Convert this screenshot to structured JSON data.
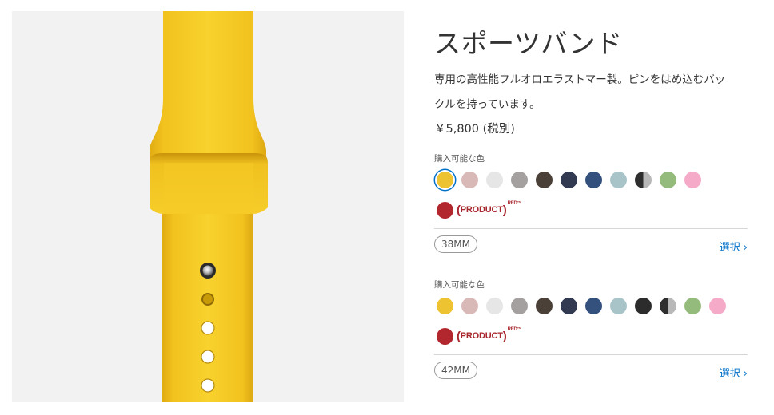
{
  "product": {
    "title": "スポーツバンド",
    "description": "専用の高性能フルオロエラストマー製。ピンをはめ込むバックルを持っています。",
    "price": "￥5,800 (税別)"
  },
  "colors": {
    "accent_link": "#0070c9",
    "band_yellow": "#f4c92a",
    "hero_background": "#f2f2f2"
  },
  "groups": [
    {
      "available_label": "購入可能な色",
      "swatches": [
        {
          "name": "yellow",
          "color": "#eec331",
          "selected": true
        },
        {
          "name": "pink-sand",
          "color": "#d9b9b8",
          "selected": false
        },
        {
          "name": "white",
          "color": "#e6e6e6",
          "selected": false
        },
        {
          "name": "stone",
          "color": "#a3a09f",
          "selected": false
        },
        {
          "name": "cocoa",
          "color": "#4b4038",
          "selected": false
        },
        {
          "name": "midnight-blue",
          "color": "#323a52",
          "selected": false
        },
        {
          "name": "ocean-blue",
          "color": "#34507d",
          "selected": false
        },
        {
          "name": "light-blue",
          "color": "#a8c4c9",
          "selected": false
        },
        {
          "name": "black-split",
          "color": "split",
          "selected": false
        },
        {
          "name": "green",
          "color": "#95bb7c",
          "selected": false
        },
        {
          "name": "light-pink",
          "color": "#f5aac8",
          "selected": false
        }
      ],
      "product_red": {
        "color": "#b2262d",
        "paren_open": "(",
        "label": "PRODUCT",
        "paren_close": ")",
        "sup": "RED™"
      },
      "size": "38MM",
      "select_label": "選択",
      "chevron": "›"
    },
    {
      "available_label": "購入可能な色",
      "swatches": [
        {
          "name": "yellow",
          "color": "#eec331",
          "selected": false
        },
        {
          "name": "pink-sand",
          "color": "#d9b9b8",
          "selected": false
        },
        {
          "name": "white",
          "color": "#e6e6e6",
          "selected": false
        },
        {
          "name": "stone",
          "color": "#a3a09f",
          "selected": false
        },
        {
          "name": "cocoa",
          "color": "#4b4038",
          "selected": false
        },
        {
          "name": "midnight-blue",
          "color": "#323a52",
          "selected": false
        },
        {
          "name": "ocean-blue",
          "color": "#34507d",
          "selected": false
        },
        {
          "name": "light-blue",
          "color": "#a8c4c9",
          "selected": false
        },
        {
          "name": "black",
          "color": "#2c2c2c",
          "selected": false
        },
        {
          "name": "black-split",
          "color": "split",
          "selected": false
        },
        {
          "name": "green",
          "color": "#95bb7c",
          "selected": false
        },
        {
          "name": "light-pink",
          "color": "#f5aac8",
          "selected": false
        }
      ],
      "product_red": {
        "color": "#b2262d",
        "paren_open": "(",
        "label": "PRODUCT",
        "paren_close": ")",
        "sup": "RED™"
      },
      "size": "42MM",
      "select_label": "選択",
      "chevron": "›"
    }
  ]
}
